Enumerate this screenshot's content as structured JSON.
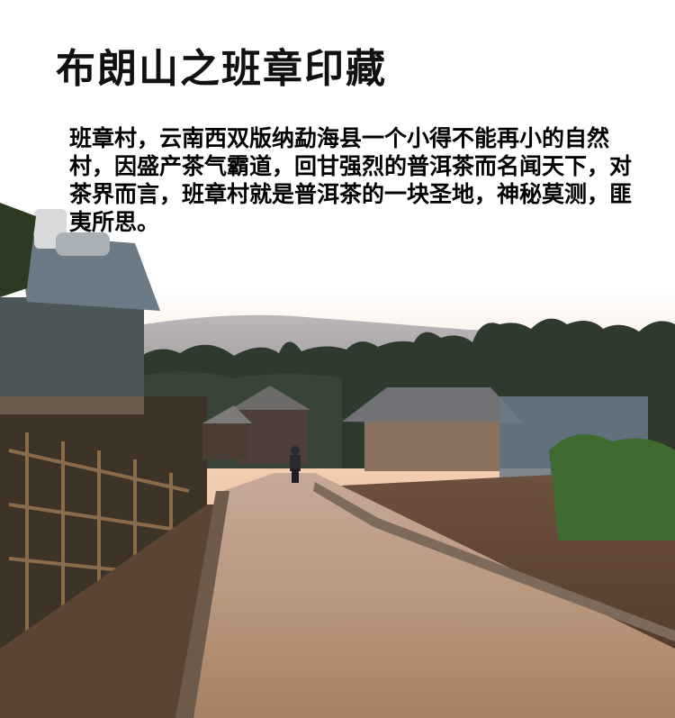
{
  "page": {
    "title": "布朗山之班章印藏",
    "paragraph": "班章村，云南西双版纳勐海县一个小得不能再小的自然村，因盛产茶气霸道，回甘强烈的普洱茶而名闻天下，对茶界而言，班章村就是普洱茶的一块圣地，神秘莫测，匪夷所思。"
  },
  "colors": {
    "sky_top": "#ffffff",
    "sky_horizon": "#f6d7bf",
    "road": "#b9987d",
    "forest": "#2f3a2e",
    "text": "#000000"
  }
}
